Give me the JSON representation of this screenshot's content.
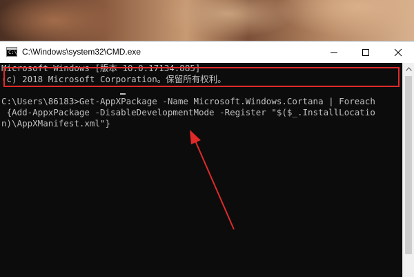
{
  "window": {
    "title": "C:\\Windows\\system32\\CMD.exe",
    "icon_prompt": "C:\\"
  },
  "console": {
    "lines": [
      "Microsoft Windows [版本 10.0.17134.885]",
      "(c) 2018 Microsoft Corporation。保留所有权利。",
      "",
      "C:\\Users\\86183>Get-AppXPackage -Name Microsoft.Windows.Cortana | Foreach",
      " {Add-AppxPackage -DisableDevelopmentMode -Register \"$($_.InstallLocatio",
      "n)\\AppXManifest.xml\"}"
    ]
  },
  "colors": {
    "console_bg": "#0c0c0c",
    "console_text": "#c0c0c0",
    "annotation": "#e02a2a"
  },
  "icons": {
    "app": "cmd-app-icon",
    "minimize": "minimize-icon",
    "maximize": "maximize-icon",
    "close": "close-icon",
    "scroll_up": "scroll-up-arrow-icon",
    "annotation": "red-arrow-icon"
  }
}
